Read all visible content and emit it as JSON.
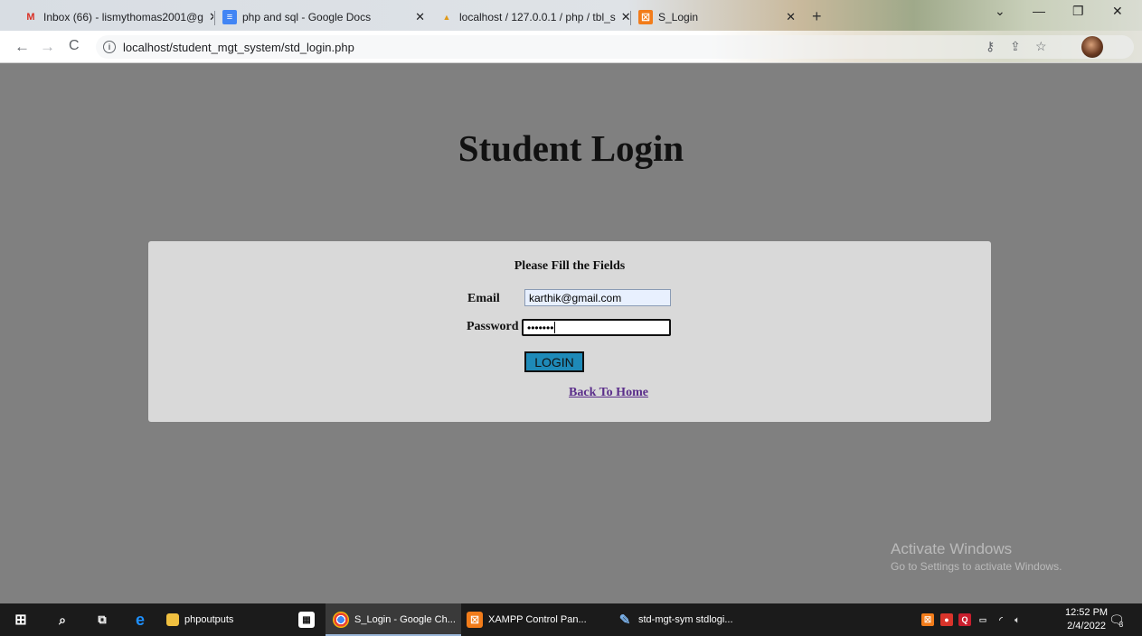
{
  "browser": {
    "tabs": [
      {
        "title": "Inbox (66) - lismythomas2001@g",
        "icon": "gmail-icon",
        "active": false
      },
      {
        "title": "php and sql - Google Docs",
        "icon": "docs-icon",
        "active": false
      },
      {
        "title": "localhost / 127.0.0.1 / php / tbl_s",
        "icon": "phpmyadmin-icon",
        "active": false
      },
      {
        "title": "S_Login",
        "icon": "xampp-icon",
        "active": true
      }
    ],
    "close_glyph": "✕",
    "new_tab_glyph": "+",
    "url": "localhost/student_mgt_system/std_login.php"
  },
  "page": {
    "title": "Student Login",
    "form": {
      "heading": "Please Fill the Fields",
      "email_label": "Email",
      "email_value": "karthik@gmail.com",
      "password_label": "Password",
      "password_mask": "•••••••",
      "login_label": "LOGIN",
      "back_link": "Back To Home"
    }
  },
  "watermark": {
    "line1": "Activate Windows",
    "line2": "Go to Settings to activate Windows."
  },
  "taskbar": {
    "apps": [
      {
        "label": "phpoutputs",
        "icon": "folder-icon"
      },
      {
        "label": "S_Login - Google Ch...",
        "icon": "chrome-icon",
        "active": true
      },
      {
        "label": "XAMPP Control Pan...",
        "icon": "xampp-icon"
      },
      {
        "label": "std-mgt-sym stdlogi...",
        "icon": "paint-icon"
      }
    ],
    "time": "12:52 PM",
    "date": "2/4/2022",
    "notifications": "3"
  },
  "colors": {
    "page_bg": "#808080",
    "panel_bg": "#d9d9d9",
    "login_button": "#1e8ab8",
    "link": "#5a2d8a"
  }
}
